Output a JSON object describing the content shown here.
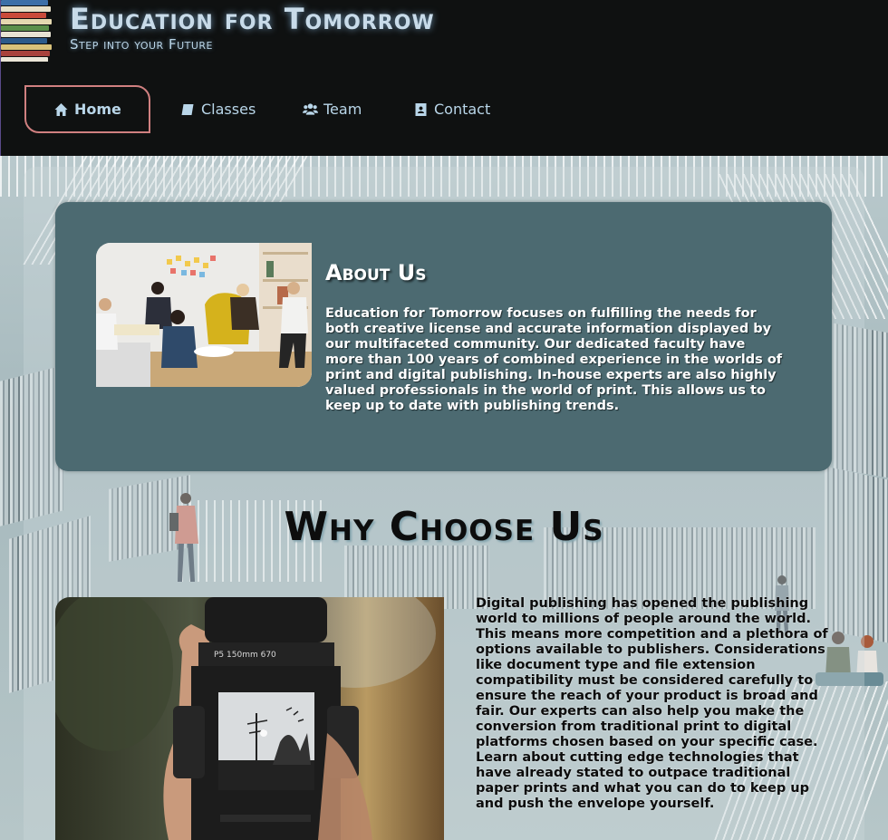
{
  "header": {
    "title": "Education for Tomorrow",
    "subtitle": "Step into your Future"
  },
  "nav": {
    "items": [
      {
        "label": "Home",
        "icon": "home-icon",
        "active": true
      },
      {
        "label": "Classes",
        "icon": "book-icon",
        "active": false
      },
      {
        "label": "Team",
        "icon": "users-icon",
        "active": false
      },
      {
        "label": "Contact",
        "icon": "contact-card-icon",
        "active": false
      }
    ]
  },
  "about": {
    "heading": "About Us",
    "text": "Education for Tomorrow focuses on fulfilling the needs for both creative license and accurate information displayed by our multifaceted community. Our dedicated faculty have more than 100 years of combined experience in the worlds of print and digital publishing. In-house experts are also highly valued professionals in the world of print. This allows us to keep up to date with publishing trends."
  },
  "why": {
    "heading": "Why Choose Us",
    "text": "Digital publishing has opened the publishing world to millions of people around the world. This means more competition and a plethora of options available to publishers. Considerations like document type and file extension compatibility must be considered carefully to ensure the reach of your product is broad and fair. Our experts can also help you make the conversion from traditional print to digital platforms chosen based on your specific case. Learn about cutting edge technologies that have already stated to outpace traditional paper prints and what you can do to keep up and push the envelope yourself.",
    "camera_lens_text": "P5 150mm 670"
  },
  "colors": {
    "header_bg": "#0f1111",
    "nav_text": "#b9d6e9",
    "active_border": "#d08080",
    "card_bg": "#4c6a71"
  }
}
